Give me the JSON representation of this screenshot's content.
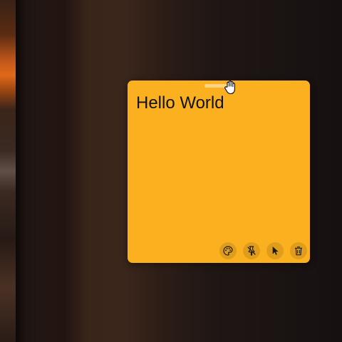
{
  "note": {
    "text": "Hello World",
    "color": "#fbb11f"
  },
  "toolbar": {
    "buttons": [
      {
        "name": "color-palette",
        "icon": "palette-icon"
      },
      {
        "name": "unpin",
        "icon": "pin-off-icon"
      },
      {
        "name": "click-through",
        "icon": "pointer-icon"
      },
      {
        "name": "delete",
        "icon": "trash-icon"
      }
    ]
  },
  "cursor": {
    "icon": "grab-hand-icon"
  }
}
